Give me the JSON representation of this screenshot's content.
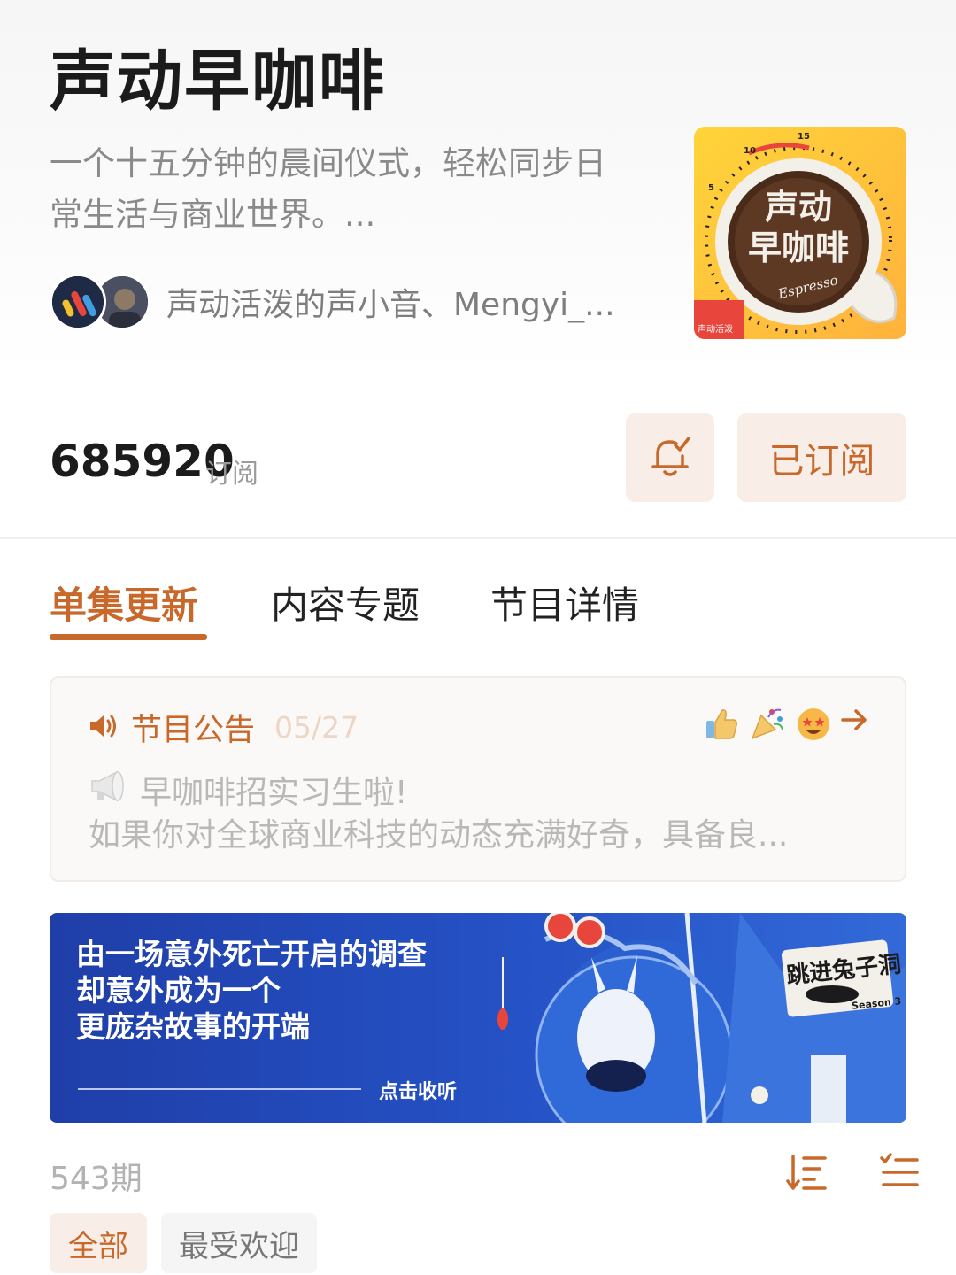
{
  "podcast": {
    "title": "声动早咖啡",
    "description_line1": "一个十五分钟的晨间仪式，轻松同步日",
    "description_line2": "常生活与商业世界。...",
    "hosts": "声动活泼的声小音、Mengyi_...",
    "cover": {
      "title_line1": "声动",
      "title_line2": "早咖啡",
      "subtitle": "Espresso",
      "brand": "声动活泼",
      "dial_labels": [
        "5",
        "10",
        "15"
      ]
    }
  },
  "subscription": {
    "count": "685920",
    "count_label": "订阅",
    "subscribe_button": "已订阅"
  },
  "tabs": [
    {
      "label": "单集更新",
      "active": true
    },
    {
      "label": "内容专题",
      "active": false
    },
    {
      "label": "节目详情",
      "active": false
    }
  ],
  "notice": {
    "title": "节目公告",
    "date": "05/27",
    "line1": "早咖啡招实习生啦!",
    "line2": "如果你对全球商业科技的动态充满好奇，具备良..."
  },
  "banner": {
    "line1": "由一场意外死亡开启的调查",
    "line2": "却意外成为一个",
    "line3": "更庞杂故事的开端",
    "cta": "点击收听",
    "show_logo": "跳进兔子洞",
    "season": "Season 3"
  },
  "episodes": {
    "count": "543期",
    "filters": [
      "全部",
      "最受欢迎"
    ]
  },
  "colors": {
    "accent": "#c8682a",
    "button_bg": "#f8eee7"
  }
}
